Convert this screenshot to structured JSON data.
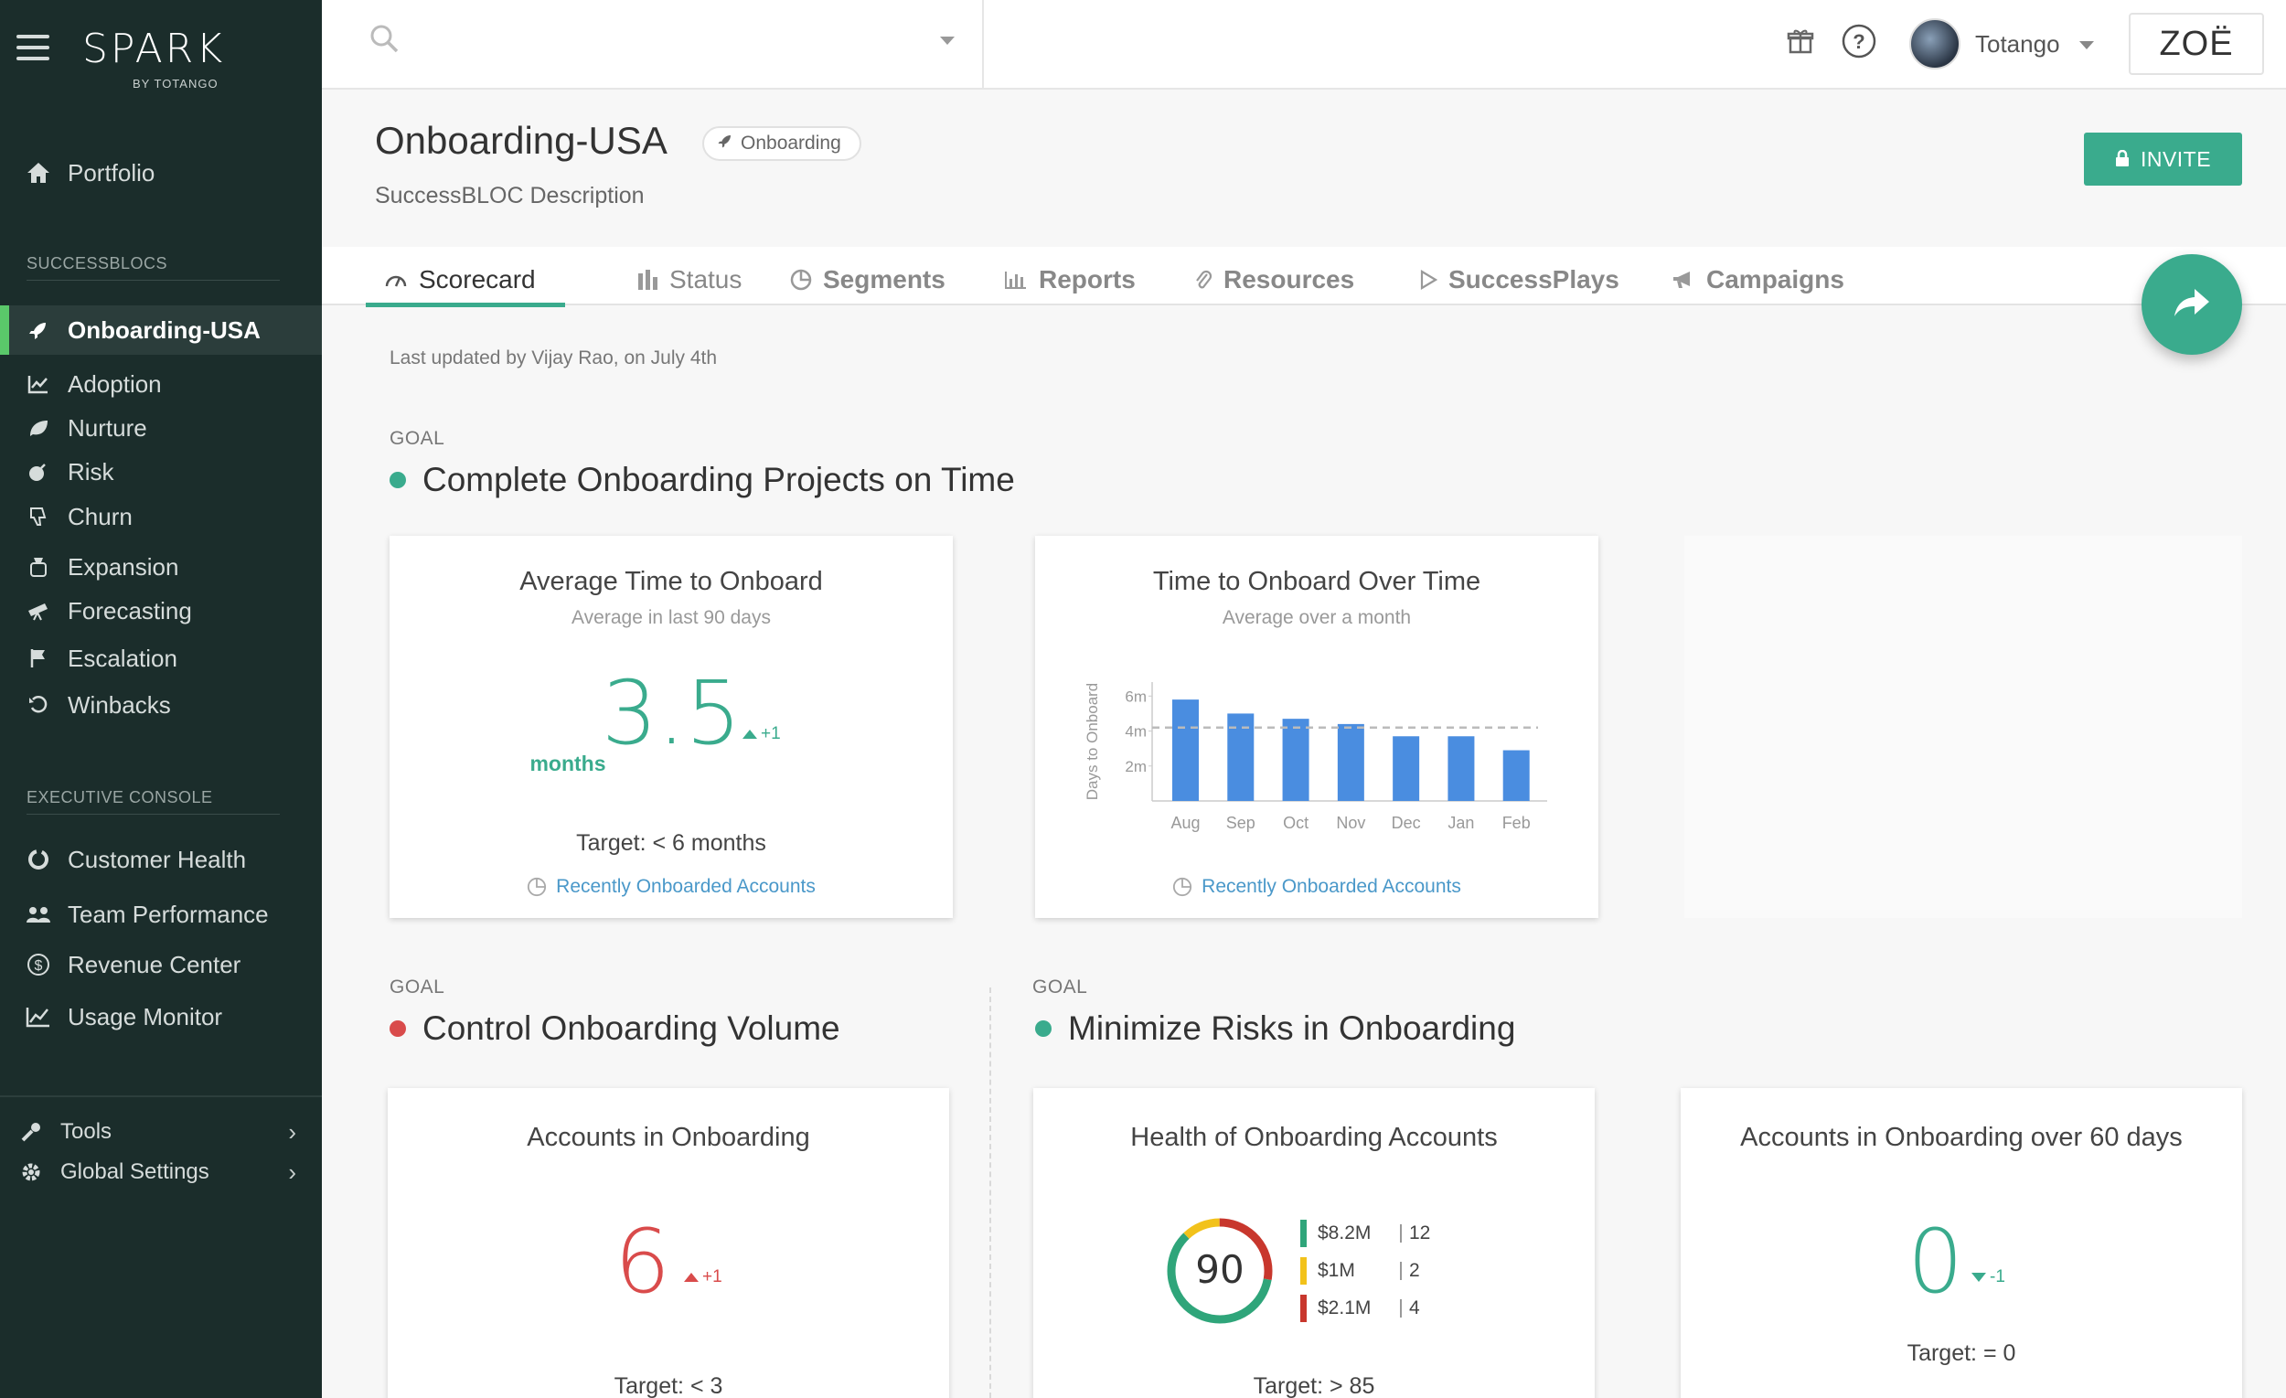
{
  "app": {
    "brand": "SPARK",
    "brand_sub": "BY TOTANGO"
  },
  "sidebar": {
    "portfolio": "Portfolio",
    "successblocs_label": "SUCCESSBLOCS",
    "successblocs": [
      {
        "label": "Onboarding-USA",
        "icon": "rocket-icon",
        "active": true
      },
      {
        "label": "Adoption",
        "icon": "chart-line-icon"
      },
      {
        "label": "Nurture",
        "icon": "leaf-icon"
      },
      {
        "label": "Risk",
        "icon": "bomb-icon"
      },
      {
        "label": "Churn",
        "icon": "thumbs-down-icon"
      },
      {
        "label": "Expansion",
        "icon": "money-bag-icon"
      },
      {
        "label": "Forecasting",
        "icon": "telescope-icon"
      },
      {
        "label": "Escalation",
        "icon": "flag-icon"
      },
      {
        "label": "Winbacks",
        "icon": "undo-icon"
      }
    ],
    "executive_label": "EXECUTIVE CONSOLE",
    "executive": [
      {
        "label": "Customer Health",
        "icon": "health-ring-icon"
      },
      {
        "label": "Team Performance",
        "icon": "users-icon"
      },
      {
        "label": "Revenue Center",
        "icon": "dollar-circle-icon"
      },
      {
        "label": "Usage Monitor",
        "icon": "area-chart-icon"
      }
    ],
    "tools": "Tools",
    "global_settings": "Global Settings"
  },
  "topbar": {
    "search_placeholder": "",
    "user_name": "Totango",
    "zoe_label": "ZOË"
  },
  "header": {
    "title": "Onboarding-USA",
    "badge": "Onboarding",
    "description": "SuccessBLOC Description",
    "invite_label": "INVITE"
  },
  "tabs": [
    {
      "label": "Scorecard",
      "active": true
    },
    {
      "label": "Status"
    },
    {
      "label": "Segments"
    },
    {
      "label": "Reports"
    },
    {
      "label": "Resources"
    },
    {
      "label": "SuccessPlays"
    },
    {
      "label": "Campaigns"
    }
  ],
  "last_updated": "Last updated by Vijay Rao, on July 4th",
  "goals": [
    {
      "label": "GOAL",
      "title": "Complete Onboarding Projects on Time",
      "status_color": "#3aab8d"
    },
    {
      "label": "GOAL",
      "title": "Control Onboarding Volume",
      "status_color": "#d94b4b"
    },
    {
      "label": "GOAL",
      "title": "Minimize Risks in Onboarding",
      "status_color": "#3aab8d"
    }
  ],
  "cards": {
    "avg_time": {
      "title": "Average Time to Onboard",
      "subtitle": "Average in last 90 days",
      "value": "3.5",
      "unit": "months",
      "delta": "+1",
      "target": "Target: < 6 months",
      "link": "Recently Onboarded Accounts"
    },
    "over_time": {
      "title": "Time to Onboard Over Time",
      "subtitle": "Average over a month",
      "link": "Recently Onboarded Accounts"
    },
    "accounts": {
      "title": "Accounts in Onboarding",
      "value": "6",
      "delta": "+1",
      "target": "Target: < 3"
    },
    "health": {
      "title": "Health of Onboarding Accounts",
      "score": "90",
      "target": "Target: > 85",
      "rows": [
        {
          "amount": "$8.2M",
          "count": "12",
          "color": "#2fa57a"
        },
        {
          "amount": "$1M",
          "count": "2",
          "color": "#f2c21b"
        },
        {
          "amount": "$2.1M",
          "count": "4",
          "color": "#c8372d"
        }
      ]
    },
    "over60": {
      "title": "Accounts in Onboarding over 60 days",
      "value": "0",
      "delta": "-1",
      "target": "Target: = 0"
    }
  },
  "chart_data": {
    "type": "bar",
    "categories": [
      "Aug",
      "Sep",
      "Oct",
      "Nov",
      "Dec",
      "Jan",
      "Feb"
    ],
    "values": [
      5.8,
      5.0,
      4.7,
      4.4,
      3.7,
      3.7,
      2.9
    ],
    "ylabel": "Days to Onboard",
    "yticks": [
      "2m",
      "4m",
      "6m"
    ],
    "ylim": [
      0,
      6.8
    ],
    "target_line": 4.2,
    "bar_color": "#4a8de0"
  }
}
